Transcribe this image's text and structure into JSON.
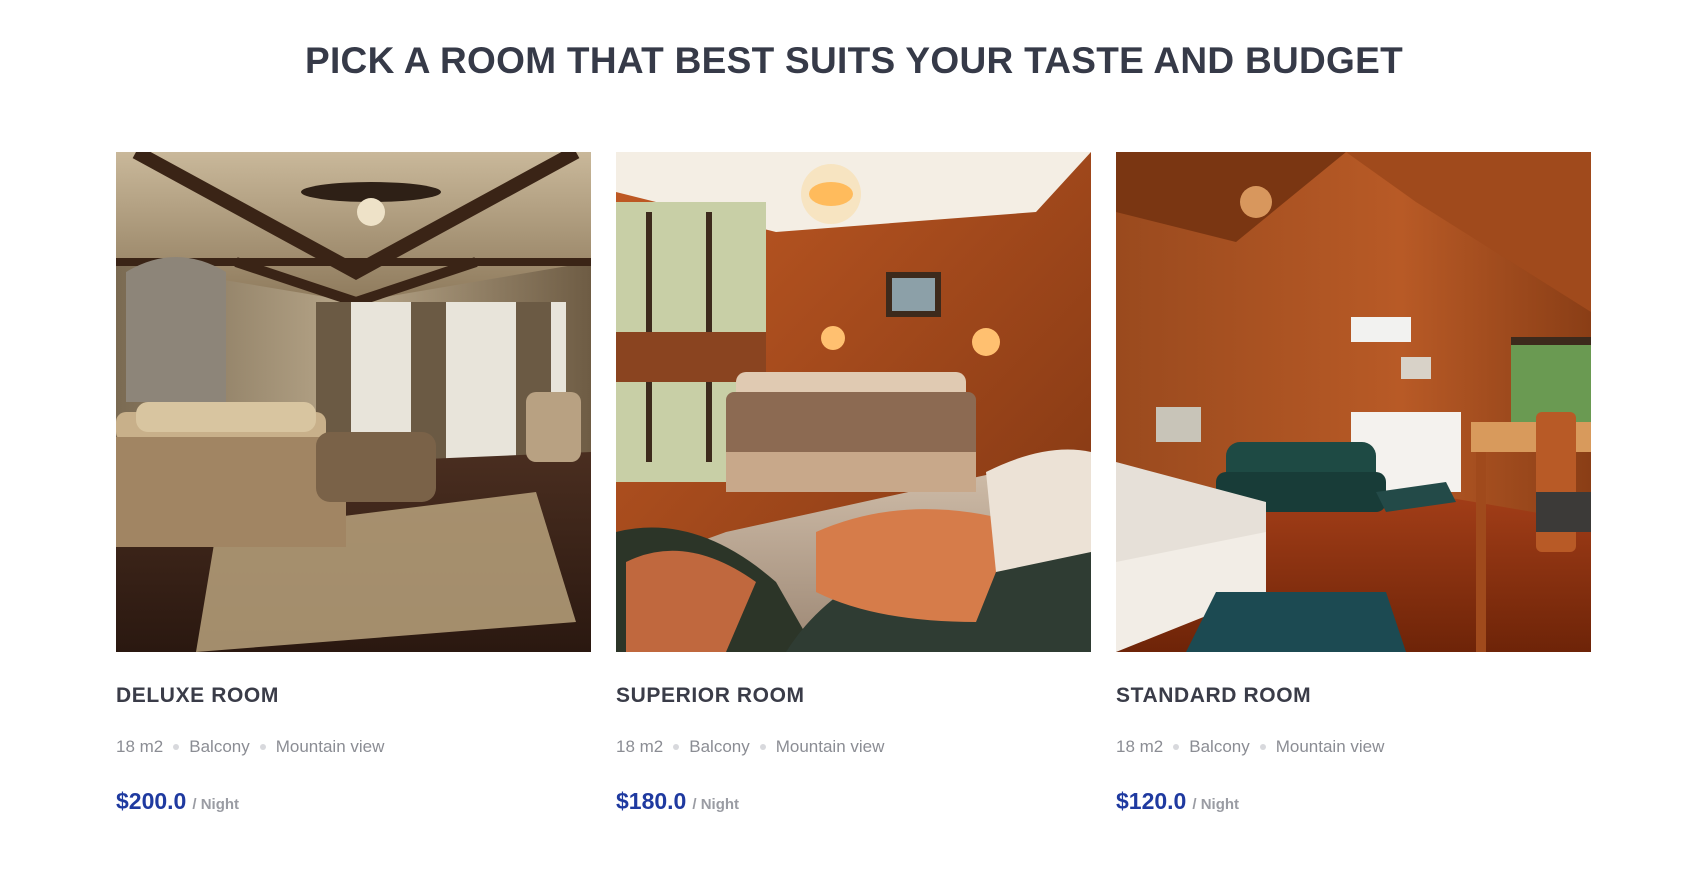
{
  "section": {
    "title": "PICK A ROOM THAT BEST SUITS YOUR TASTE AND BUDGET"
  },
  "rooms": [
    {
      "name": "DELUXE ROOM",
      "features": [
        "18 m2",
        "Balcony",
        "Mountain view"
      ],
      "price": "$200.0",
      "unit": "/ Night",
      "photo_icon": "bedroom-photo-deluxe"
    },
    {
      "name": "SUPERIOR ROOM",
      "features": [
        "18 m2",
        "Balcony",
        "Mountain view"
      ],
      "price": "$180.0",
      "unit": "/ Night",
      "photo_icon": "bedroom-photo-superior"
    },
    {
      "name": "STANDARD ROOM",
      "features": [
        "18 m2",
        "Balcony",
        "Mountain view"
      ],
      "price": "$120.0",
      "unit": "/ Night",
      "photo_icon": "bedroom-photo-standard"
    }
  ],
  "colors": {
    "title": "#363a48",
    "price": "#1f3aa0",
    "muted": "#8b8d94"
  }
}
